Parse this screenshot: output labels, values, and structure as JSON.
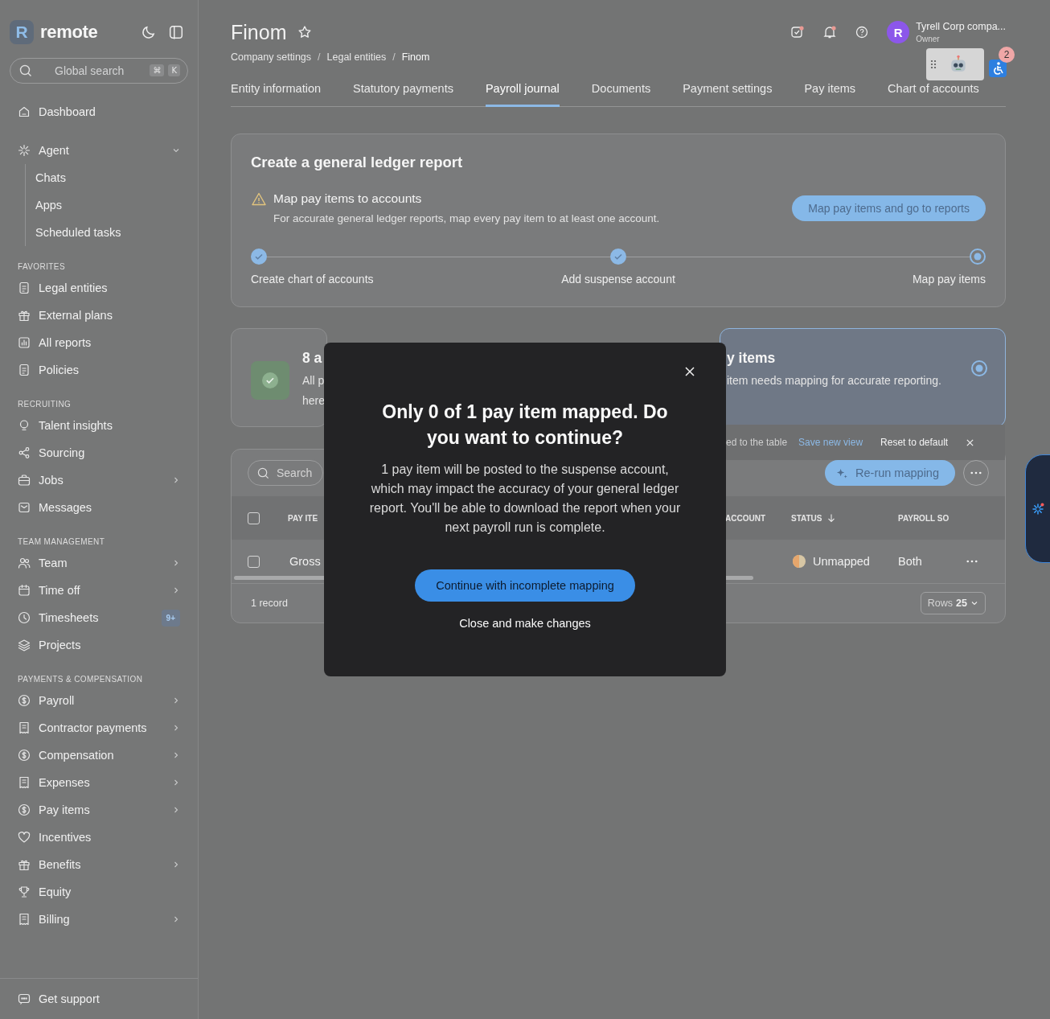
{
  "brand": {
    "logo_mark": "R",
    "name": "remote"
  },
  "global_search": {
    "placeholder": "Global search",
    "keys": [
      "⌘",
      "K"
    ]
  },
  "nav": [
    {
      "items": [
        {
          "label": "Dashboard",
          "chevron": false
        }
      ]
    },
    {
      "items": [
        {
          "label": "Agent",
          "chevron": true,
          "expanded": true,
          "children": [
            {
              "label": "Chats"
            },
            {
              "label": "Apps"
            },
            {
              "label": "Scheduled tasks"
            }
          ]
        }
      ]
    },
    {
      "heading": "FAVORITES",
      "items": [
        {
          "label": "Legal entities",
          "chevron": false
        },
        {
          "label": "External plans",
          "chevron": false
        },
        {
          "label": "All reports",
          "chevron": false
        },
        {
          "label": "Policies",
          "chevron": false
        }
      ]
    },
    {
      "heading": "RECRUITING",
      "items": [
        {
          "label": "Talent insights",
          "chevron": false
        },
        {
          "label": "Sourcing",
          "chevron": false
        },
        {
          "label": "Jobs",
          "chevron": true
        },
        {
          "label": "Messages",
          "chevron": false
        }
      ]
    },
    {
      "heading": "TEAM MANAGEMENT",
      "items": [
        {
          "label": "Team",
          "chevron": true
        },
        {
          "label": "Time off",
          "chevron": true
        },
        {
          "label": "Timesheets",
          "chevron": false,
          "badge": "9+"
        },
        {
          "label": "Projects",
          "chevron": false
        }
      ]
    },
    {
      "heading": "PAYMENTS & COMPENSATION",
      "items": [
        {
          "label": "Payroll",
          "chevron": true
        },
        {
          "label": "Contractor payments",
          "chevron": true
        },
        {
          "label": "Compensation",
          "chevron": true
        },
        {
          "label": "Expenses",
          "chevron": true
        },
        {
          "label": "Pay items",
          "chevron": true
        },
        {
          "label": "Incentives",
          "chevron": false
        },
        {
          "label": "Benefits",
          "chevron": true
        },
        {
          "label": "Equity",
          "chevron": false
        },
        {
          "label": "Billing",
          "chevron": true
        }
      ]
    }
  ],
  "sidebar_footer": {
    "label": "Get support"
  },
  "header": {
    "title": "Finom",
    "user": {
      "initial": "R",
      "name": "Tyrell Corp compa...",
      "role": "Owner"
    }
  },
  "breadcrumbs": [
    {
      "label": "Company settings",
      "separator": "/"
    },
    {
      "label": "Legal entities",
      "separator": "/"
    },
    {
      "label": "Finom"
    }
  ],
  "tabs": [
    {
      "label": "Entity information",
      "selected": false
    },
    {
      "label": "Statutory payments",
      "selected": false
    },
    {
      "label": "Payroll journal",
      "selected": true
    },
    {
      "label": "Documents",
      "selected": false
    },
    {
      "label": "Payment settings",
      "selected": false
    },
    {
      "label": "Pay items",
      "selected": false
    },
    {
      "label": "Chart of accounts",
      "selected": false
    }
  ],
  "widget": {
    "badge": "2"
  },
  "ledger_card": {
    "title": "Create a general ledger report",
    "alert_title": "Map pay items to accounts",
    "alert_text": "For accurate general ledger reports, map every pay item to at least one account.",
    "button": "Map pay items and go to reports",
    "steps": [
      {
        "label": "Create chart of accounts",
        "done": true
      },
      {
        "label": "Add suspense account",
        "done": true
      },
      {
        "label": "Map pay items",
        "done": false
      }
    ]
  },
  "summary_cards": [
    {
      "done": true,
      "title": "8 a",
      "lines": [
        "All p",
        "here"
      ]
    },
    {
      "done": false,
      "title": "y items",
      "lines": [
        "item needs mapping for accurate reporting."
      ]
    }
  ],
  "toast": {
    "text": "ed to the table",
    "link": "Save new view",
    "reset": "Reset to default"
  },
  "table": {
    "search_placeholder": "Search",
    "rerun_button": "Re-run mapping",
    "select_all": false,
    "columns": [
      {
        "label": "PAY ITE"
      },
      {
        "label": "ACCOUNT"
      },
      {
        "label": "STATUS",
        "sorted": true
      },
      {
        "label": "PAYROLL SO"
      }
    ],
    "rows": [
      {
        "selected": false,
        "pay_item": "Gross",
        "status": "Unmapped",
        "mapped": false,
        "payroll_source": "Both"
      }
    ],
    "record_count": "1 record",
    "rows_label": "Rows",
    "rows_value": "25"
  },
  "modal": {
    "title": "Only 0 of 1 pay item mapped. Do you want to continue?",
    "body": "1 pay item will be posted to the suspense account, which may impact the accuracy of your general ledger report. You'll be able to download the report when your next payroll run is complete.",
    "primary": "Continue with incomplete mapping",
    "secondary": "Close and make changes"
  }
}
